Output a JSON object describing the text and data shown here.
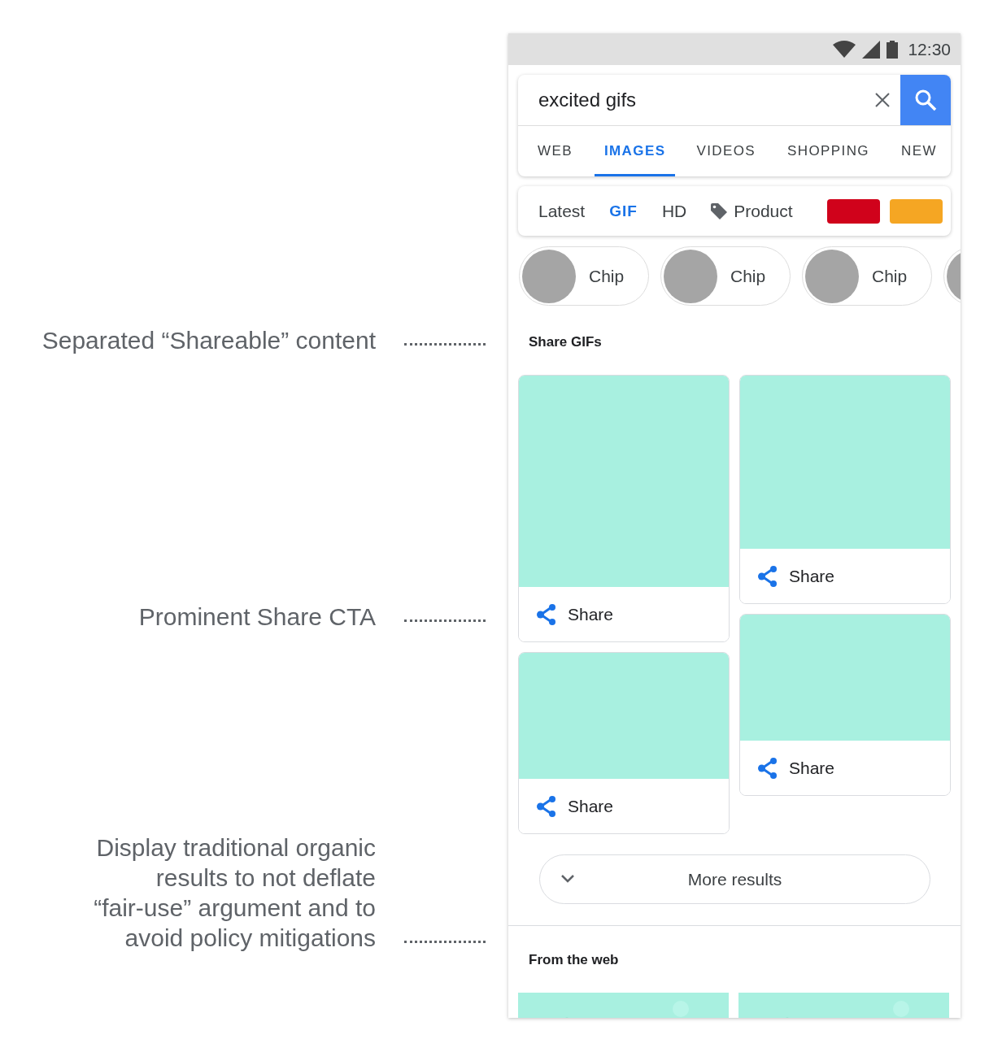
{
  "annotations": [
    {
      "lines": [
        "Separated “Shareable” content"
      ]
    },
    {
      "lines": [
        "Prominent Share CTA"
      ]
    },
    {
      "lines": [
        "Display traditional organic",
        "results to not deflate",
        "“fair-use” argument and to",
        "avoid policy mitigations"
      ]
    }
  ],
  "status_bar": {
    "time": "12:30"
  },
  "search": {
    "value": "excited gifs"
  },
  "tabs": [
    {
      "label": "WEB",
      "selected": false
    },
    {
      "label": "IMAGES",
      "selected": true
    },
    {
      "label": "VIDEOS",
      "selected": false
    },
    {
      "label": "SHOPPING",
      "selected": false
    },
    {
      "label": "NEW",
      "selected": false
    }
  ],
  "filters": [
    {
      "kind": "text",
      "label": "Latest",
      "selected": false
    },
    {
      "kind": "text",
      "label": "GIF",
      "selected": true
    },
    {
      "kind": "text",
      "label": "HD",
      "selected": false
    },
    {
      "kind": "tag",
      "label": "Product",
      "selected": false
    },
    {
      "kind": "swatch",
      "color": "#d0021b"
    },
    {
      "kind": "swatch",
      "color": "#f5a623"
    }
  ],
  "chips": [
    {
      "kind": "full",
      "label": "Chip"
    },
    {
      "kind": "full",
      "label": "Chip"
    },
    {
      "kind": "full",
      "label": "Chip"
    },
    {
      "kind": "partial"
    }
  ],
  "share_section": {
    "title": "Share GIFs",
    "columns": [
      {
        "cards": [
          {
            "action": "Share"
          },
          {
            "action": "Share"
          }
        ]
      },
      {
        "cards": [
          {
            "action": "Share"
          },
          {
            "action": "Share"
          }
        ]
      }
    ]
  },
  "more_button": {
    "label": "More results"
  },
  "web_section": {
    "title": "From the web"
  }
}
